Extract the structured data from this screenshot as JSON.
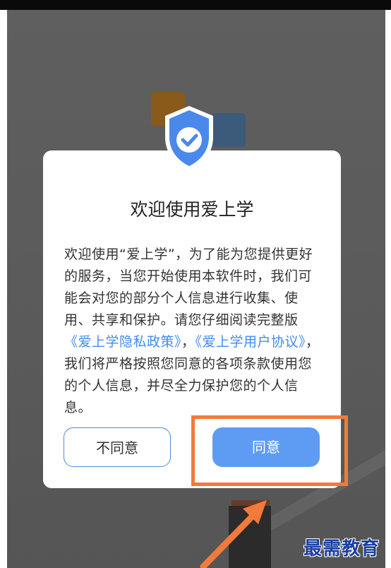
{
  "dialog": {
    "title": "欢迎使用爱上学",
    "body_part1": "欢迎使用“爱上学”，为了能为您提供更好的服务，当您开始使用本软件时，我们可能会对您的部分个人信息进行收集、使用、共享和保护。请您仔细阅读完整版",
    "privacy_link": "《爱上学隐私政策》",
    "separator": "，",
    "terms_link": "《爱上学用户协议》",
    "body_part2": "，我们将严格按照您同意的各项条款使用您的个人信息，并尽全力保护您的个人信息。",
    "disagree_label": "不同意",
    "agree_label": "同意"
  },
  "watermark": "最需教育",
  "colors": {
    "accent": "#5e9cf3",
    "link": "#3f8cf0",
    "highlight": "#f27a3b",
    "overlay": "#5c5c5c"
  },
  "icons": {
    "shield": "shield-check-icon",
    "arrow": "arrow-pointer-icon"
  }
}
